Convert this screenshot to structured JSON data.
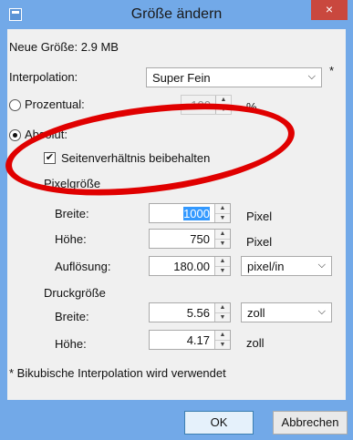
{
  "window": {
    "title": "Größe ändern",
    "close_glyph": "×"
  },
  "new_size": "Neue Größe: 2.9 MB",
  "interpolation": {
    "label": "Interpolation:",
    "value": "Super Fein",
    "note": "*"
  },
  "mode": {
    "percent_label": "Prozentual:",
    "percent_value": "100",
    "percent_unit": "%",
    "absolute_label": "Absolut:",
    "keep_ratio_label": "Seitenverhältnis beibehalten",
    "absolute_selected": true,
    "keep_ratio_checked": true
  },
  "pixel_size": {
    "heading": "Pixelgröße",
    "width_label": "Breite:",
    "width_value": "1000",
    "width_unit": "Pixel",
    "height_label": "Höhe:",
    "height_value": "750",
    "height_unit": "Pixel",
    "resolution_label": "Auflösung:",
    "resolution_value": "180.00",
    "resolution_unit": "pixel/in"
  },
  "print_size": {
    "heading": "Druckgröße",
    "width_label": "Breite:",
    "width_value": "5.56",
    "width_unit": "zoll",
    "height_label": "Höhe:",
    "height_value": "4.17",
    "height_unit": "zoll"
  },
  "footnote": "* Bikubische Interpolation wird verwendet",
  "buttons": {
    "ok": "OK",
    "cancel": "Abbrechen"
  },
  "icons": {
    "spin_up": "▲",
    "spin_down": "▼",
    "dropdown": "⌵",
    "check": "✔"
  },
  "colors": {
    "title_bar": "#72a9e8",
    "close": "#c9483e",
    "annotation": "#e00000"
  }
}
